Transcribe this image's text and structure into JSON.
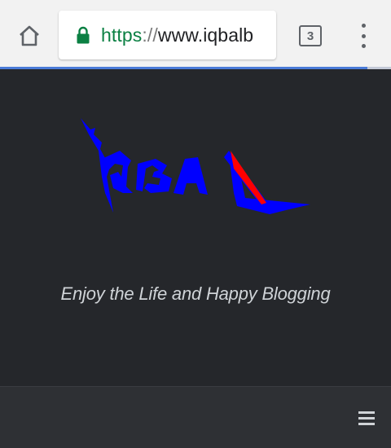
{
  "browser": {
    "url_scheme": "https",
    "url_separator": "://",
    "url_host": "www.iqbalb",
    "tab_count": "3",
    "page_load_progress": 0.94
  },
  "site": {
    "logo_text": "IQBAL",
    "logo_colors": {
      "primary": "#0000ff",
      "accent": "#ff0000"
    },
    "tagline": "Enjoy the Life and Happy Blogging"
  },
  "icons": {
    "home": "home-icon",
    "lock": "lock-icon",
    "tabs": "tab-switcher-icon",
    "overflow": "more-vert-icon",
    "nav": "hamburger-menu-icon"
  },
  "colors": {
    "secure_green": "#0b8043",
    "page_background": "#25272b",
    "navbar_background": "#2e3034",
    "progress": "#4a7bd8"
  }
}
